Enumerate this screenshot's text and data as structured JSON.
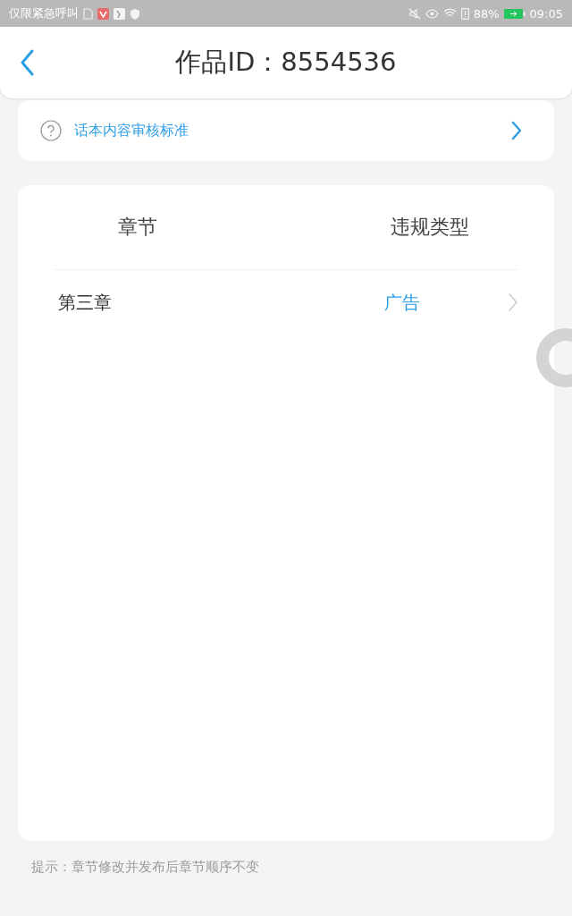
{
  "status_bar": {
    "carrier": "仅限紧急呼叫",
    "battery": "88%",
    "time": "09:05"
  },
  "header": {
    "title": "作品ID：8554536"
  },
  "guideline_link": {
    "label": "话本内容审核标准"
  },
  "table": {
    "columns": [
      "章节",
      "违规类型"
    ],
    "rows": [
      {
        "chapter": "第三章",
        "violation": "广告"
      }
    ]
  },
  "hint": "提示：章节修改并发布后章节顺序不变"
}
